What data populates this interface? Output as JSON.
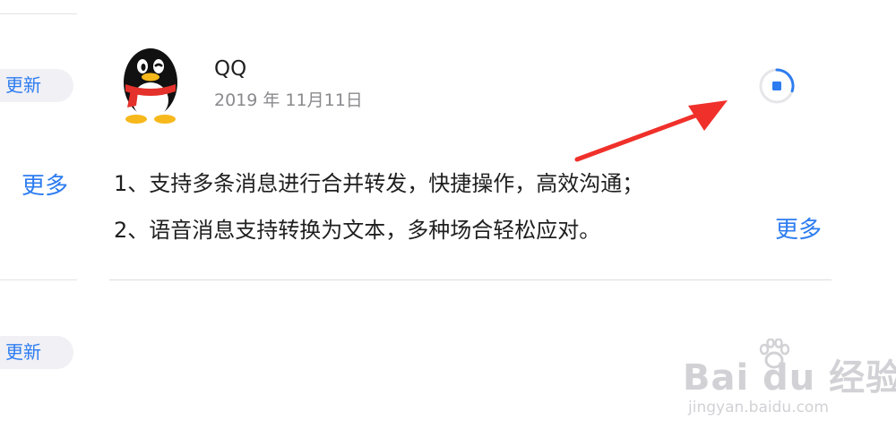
{
  "left_column": {
    "update_button_1": "更新",
    "more_link": "更多",
    "update_button_2": "更新"
  },
  "app": {
    "name": "QQ",
    "date": "2019 年 11月11日",
    "icon": "qq-penguin-icon",
    "download_state": "downloading",
    "download_progress": 0.3,
    "release_notes": [
      "1、支持多条消息进行合并转发，快捷操作，高效沟通；",
      "2、语音消息支持转换为文本，多种场合轻松应对。"
    ],
    "more_link": "更多"
  },
  "annotation": {
    "arrow_color": "#f0302a",
    "icon": "red-arrow-icon"
  },
  "watermark": {
    "main": "Bai du 经验",
    "sub": "jingyan.baidu.com"
  },
  "colors": {
    "accent": "#2d7cf0",
    "text": "#1f1f1f",
    "secondary_text": "#8a8a8e",
    "divider": "#dcdce0"
  }
}
